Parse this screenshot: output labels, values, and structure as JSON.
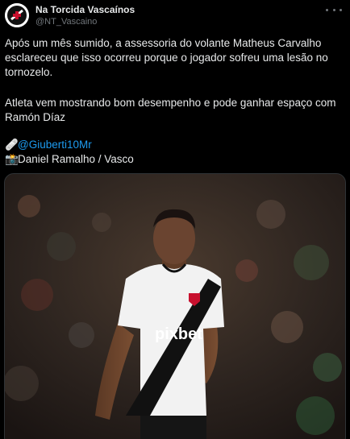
{
  "account": {
    "display_name": "Na Torcida Vascaínos",
    "handle": "@NT_Vascaino",
    "avatar_icon": "vasco-crest-icon",
    "more_icon": "more-options-icon"
  },
  "tweet": {
    "paragraph_1": "Após um mês sumido, a assessoria do volante Matheus Carvalho esclareceu que isso ocorreu porque o jogador sofreu uma lesão no tornozelo.",
    "paragraph_2": "Atleta vem mostrando bom desempenho e pode ganhar espaço com Ramón Díaz",
    "credit_1_emoji": "🩹",
    "credit_1_mention": "@Giuberti10Mr",
    "credit_2_emoji": "📸",
    "credit_2_text": "Daniel Ramalho / Vasco"
  },
  "media": {
    "description_icon": "player-photo",
    "jersey_sponsor": "pixbet",
    "colors": {
      "jersey": "#f2f2f2",
      "sash": "#111111",
      "crest": "#c8102e"
    }
  }
}
